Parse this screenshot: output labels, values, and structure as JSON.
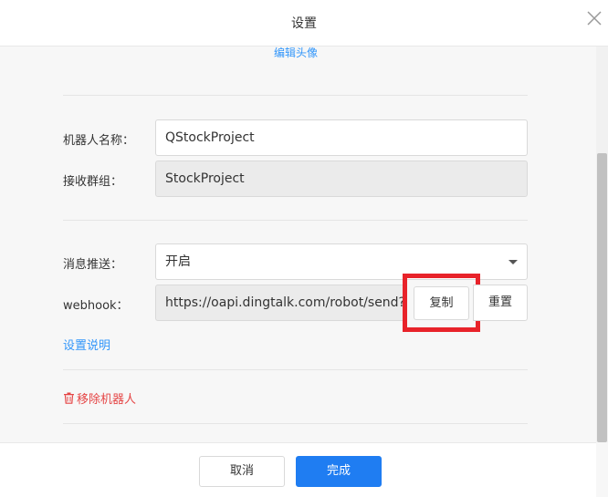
{
  "header": {
    "title": "设置"
  },
  "avatar": {
    "edit_label": "编辑头像"
  },
  "form": {
    "robot_name": {
      "label": "机器人名称：",
      "value": "QStockProject"
    },
    "receive_group": {
      "label": "接收群组：",
      "value": "StockProject"
    },
    "message_push": {
      "label": "消息推送：",
      "value": "开启"
    },
    "webhook": {
      "label": "webhook：",
      "value": "https://oapi.dingtalk.com/robot/send?",
      "copy_label": "复制",
      "reset_label": "重置"
    },
    "help_link": "设置说明",
    "remove_robot": "移除机器人"
  },
  "footer": {
    "cancel_label": "取消",
    "done_label": "完成"
  },
  "colors": {
    "accent": "#1f7df2",
    "link": "#3296fa",
    "danger": "#e54545",
    "highlight": "#e8232a"
  },
  "icons": {
    "close": "close-icon",
    "caret": "chevron-down-icon",
    "trash": "trash-icon"
  }
}
